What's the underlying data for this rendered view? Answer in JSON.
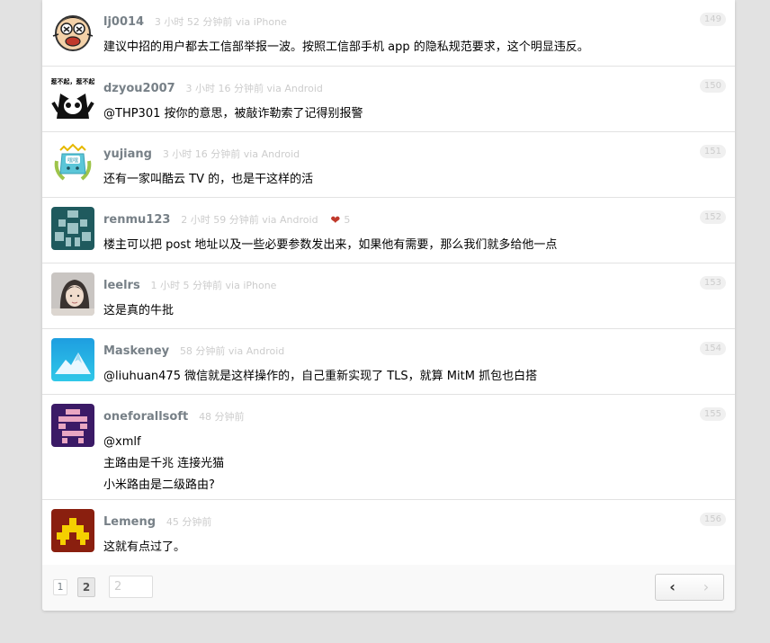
{
  "replies": [
    {
      "user": "lj0014",
      "ago": "3 小时 52 分钟前 via iPhone",
      "floor": "149",
      "likes": "",
      "lines": [
        "建议中招的用户都去工信部举报一波。按照工信部手机 app 的隐私规范要求，这个明显违反。"
      ]
    },
    {
      "user": "dzyou2007",
      "ago": "3 小时 16 分钟前 via Android",
      "floor": "150",
      "likes": "",
      "lines": [
        "@THP301 按你的意思，被敲诈勒索了记得别报警"
      ]
    },
    {
      "user": "yujiang",
      "ago": "3 小时 16 分钟前 via Android",
      "floor": "151",
      "likes": "",
      "lines": [
        "还有一家叫酷云 TV 的，也是干这样的活"
      ]
    },
    {
      "user": "renmu123",
      "ago": "2 小时 59 分钟前 via Android",
      "floor": "152",
      "likes": "5",
      "lines": [
        "楼主可以把 post 地址以及一些必要参数发出来，如果他有需要，那么我们就多给他一点"
      ]
    },
    {
      "user": "leelrs",
      "ago": "1 小时 5 分钟前 via iPhone",
      "floor": "153",
      "likes": "",
      "lines": [
        "这是真的牛批"
      ]
    },
    {
      "user": "Maskeney",
      "ago": "58 分钟前 via Android",
      "floor": "154",
      "likes": "",
      "lines": [
        "@liuhuan475 微信就是这样操作的，自己重新实现了 TLS，就算 MitM 抓包也白搭"
      ]
    },
    {
      "user": "oneforallsoft",
      "ago": "48 分钟前",
      "floor": "155",
      "likes": "",
      "lines": [
        "@xmlf",
        "主路由是千兆 连接光猫",
        "小米路由是二级路由?"
      ]
    },
    {
      "user": "Lemeng",
      "ago": "45 分钟前",
      "floor": "156",
      "likes": "",
      "lines": [
        "这就有点过了。"
      ]
    }
  ],
  "avatar_text": {
    "dzyou2007": "惹不起，惹不起",
    "yujiang": "嘿嘿"
  },
  "pagination": {
    "page1": "1",
    "page2": "2",
    "input_value": "2",
    "prev": "‹",
    "next": "›"
  }
}
